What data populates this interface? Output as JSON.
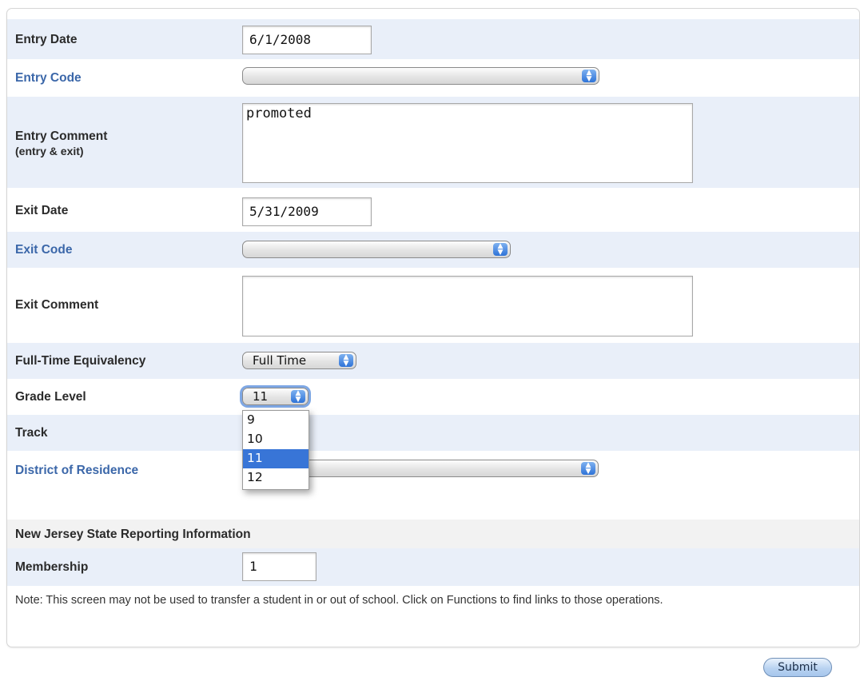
{
  "form": {
    "entry_date": {
      "label": "Entry Date",
      "value": "6/1/2008"
    },
    "entry_code": {
      "label": "Entry Code",
      "value": ""
    },
    "entry_comment": {
      "label": "Entry Comment",
      "sublabel": "(entry & exit)",
      "value": "promoted"
    },
    "exit_date": {
      "label": "Exit Date",
      "value": "5/31/2009"
    },
    "exit_code": {
      "label": "Exit Code",
      "value": ""
    },
    "exit_comment": {
      "label": "Exit Comment",
      "value": ""
    },
    "fte": {
      "label": "Full-Time Equivalency",
      "value": "Full Time"
    },
    "grade_level": {
      "label": "Grade Level",
      "value": "11",
      "options": [
        "9",
        "10",
        "11",
        "12"
      ],
      "selected_index": 2
    },
    "track": {
      "label": "Track"
    },
    "district": {
      "label": "District of Residence",
      "value": ""
    },
    "nj_section": {
      "label": "New Jersey State Reporting Information"
    },
    "membership": {
      "label": "Membership",
      "value": "1"
    }
  },
  "note": "Note: This screen may not be used to transfer a student in or out of school. Click on Functions to find links to those operations.",
  "submit_label": "Submit"
}
